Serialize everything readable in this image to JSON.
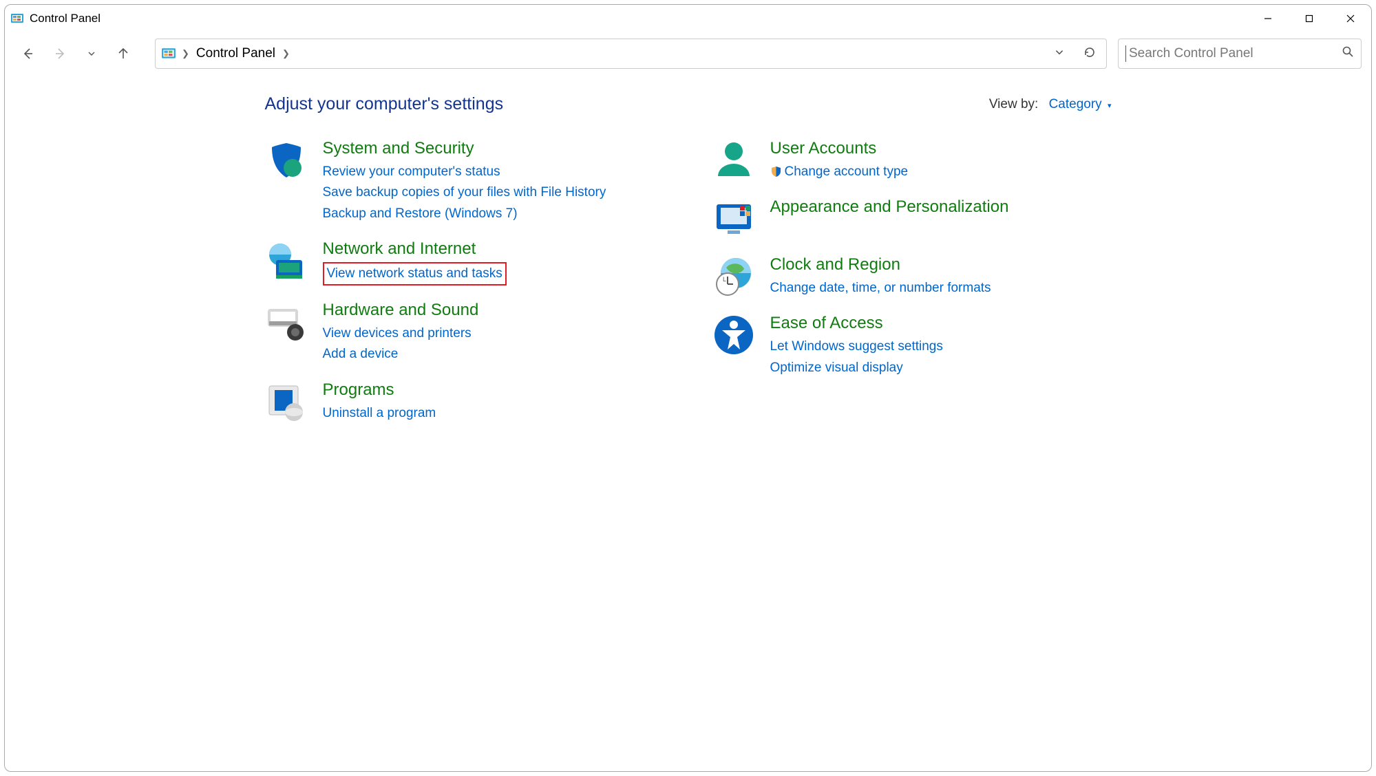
{
  "window": {
    "title": "Control Panel"
  },
  "breadcrumb": {
    "item": "Control Panel"
  },
  "search": {
    "placeholder": "Search Control Panel"
  },
  "header": {
    "title": "Adjust your computer's settings",
    "viewby_label": "View by:",
    "viewby_value": "Category"
  },
  "left_col": [
    {
      "title": "System and Security",
      "links": [
        "Review your computer's status",
        "Save backup copies of your files with File History",
        "Backup and Restore (Windows 7)"
      ]
    },
    {
      "title": "Network and Internet",
      "links": [
        "View network status and tasks"
      ],
      "highlight_index": 0
    },
    {
      "title": "Hardware and Sound",
      "links": [
        "View devices and printers",
        "Add a device"
      ]
    },
    {
      "title": "Programs",
      "links": [
        "Uninstall a program"
      ]
    }
  ],
  "right_col": [
    {
      "title": "User Accounts",
      "links": [
        "Change account type"
      ],
      "shield_index": 0
    },
    {
      "title": "Appearance and Personalization",
      "links": []
    },
    {
      "title": "Clock and Region",
      "links": [
        "Change date, time, or number formats"
      ]
    },
    {
      "title": "Ease of Access",
      "links": [
        "Let Windows suggest settings",
        "Optimize visual display"
      ]
    }
  ]
}
